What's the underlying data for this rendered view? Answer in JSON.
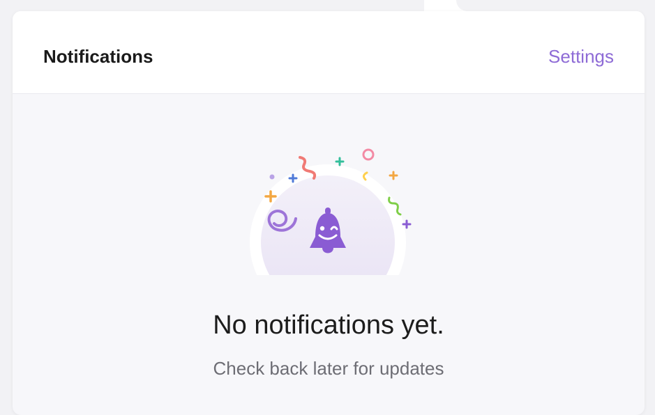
{
  "header": {
    "title": "Notifications",
    "settings_label": "Settings"
  },
  "empty_state": {
    "title": "No notifications yet.",
    "subtitle": "Check back later for updates",
    "illustration_icon": "bell-icon"
  },
  "colors": {
    "accent": "#8e6bd6",
    "bell": "#8a5cd3",
    "background": "#f7f7fa",
    "header_bg": "#ffffff"
  }
}
